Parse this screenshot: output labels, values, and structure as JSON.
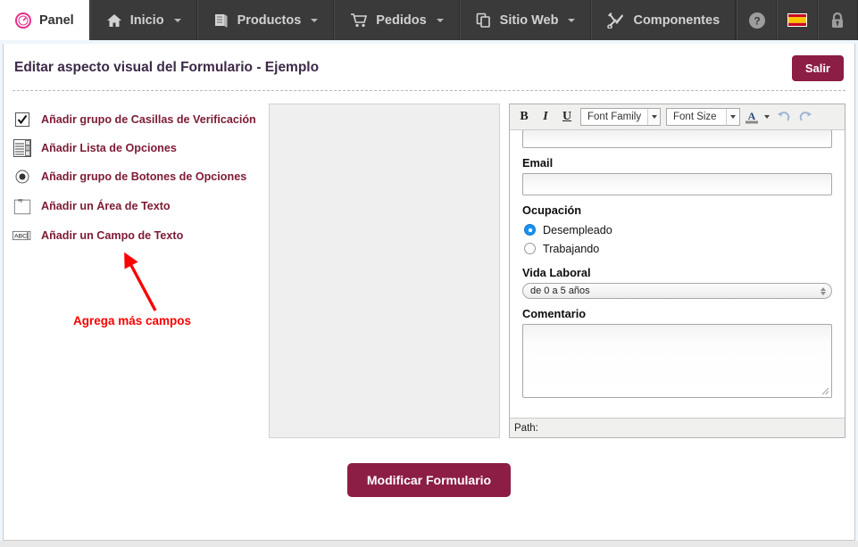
{
  "topnav": {
    "items": [
      {
        "label": "Panel",
        "icon": "gauge-icon",
        "active": true,
        "caret": false
      },
      {
        "label": "Inicio",
        "icon": "home-icon",
        "active": false,
        "caret": true
      },
      {
        "label": "Productos",
        "icon": "books-icon",
        "active": false,
        "caret": true
      },
      {
        "label": "Pedidos",
        "icon": "cart-icon",
        "active": false,
        "caret": true
      },
      {
        "label": "Sitio Web",
        "icon": "copy-icon",
        "active": false,
        "caret": true
      },
      {
        "label": "Componentes",
        "icon": "tools-icon",
        "active": false,
        "caret": false
      }
    ],
    "right_icons": [
      {
        "name": "help-icon",
        "title": "Ayuda"
      },
      {
        "name": "spain-flag-icon",
        "title": "Espanol"
      },
      {
        "name": "lock-icon",
        "title": "Bloquear"
      }
    ]
  },
  "header": {
    "title": "Editar aspecto visual del Formulario - Ejemplo",
    "exit_label": "Salir"
  },
  "sidebar": {
    "items": [
      {
        "label": "Añadir grupo de Casillas de Verificación",
        "icon": "checkbox-icon"
      },
      {
        "label": "Añadir Lista de Opciones",
        "icon": "listbox-icon"
      },
      {
        "label": "Añadir grupo de Botones de Opciones",
        "icon": "radio-icon"
      },
      {
        "label": "Añadir un Área de Texto",
        "icon": "textarea-icon"
      },
      {
        "label": "Añadir un Campo de Texto",
        "icon": "textfield-icon"
      }
    ],
    "annotation": {
      "text": "Agrega más campos",
      "color": "#fb0000",
      "arrow": "red-arrow-up-left"
    }
  },
  "editor": {
    "toolbar": {
      "bold": "B",
      "italic": "I",
      "underline": "U",
      "font_family_label": "Font Family",
      "font_size_label": "Font Size",
      "fore_color": "forecolor-icon",
      "undo": "undo-icon",
      "redo": "redo-icon"
    },
    "form_preview": {
      "fields": [
        {
          "type": "text",
          "label": "",
          "value": "",
          "cut_off": true
        },
        {
          "type": "text",
          "label": "Email",
          "value": ""
        },
        {
          "type": "radiogroup",
          "label": "Ocupación",
          "options": [
            {
              "label": "Desempleado",
              "selected": true
            },
            {
              "label": "Trabajando",
              "selected": false
            }
          ]
        },
        {
          "type": "select",
          "label": "Vida Laboral",
          "value": "de 0 a 5 años"
        },
        {
          "type": "textarea",
          "label": "Comentario",
          "value": ""
        }
      ]
    },
    "status": {
      "path_label": "Path:"
    }
  },
  "footer": {
    "submit_label": "Modificar Formulario"
  },
  "colors": {
    "nav_bg": "#3a3a3a",
    "brand": "#8c1d45",
    "title": "#3d2a47",
    "sidebar_link": "#7d1a34",
    "annotation": "#fb0000",
    "page_bg": "#eef6fb",
    "radio_selected": "#1b91f0"
  }
}
